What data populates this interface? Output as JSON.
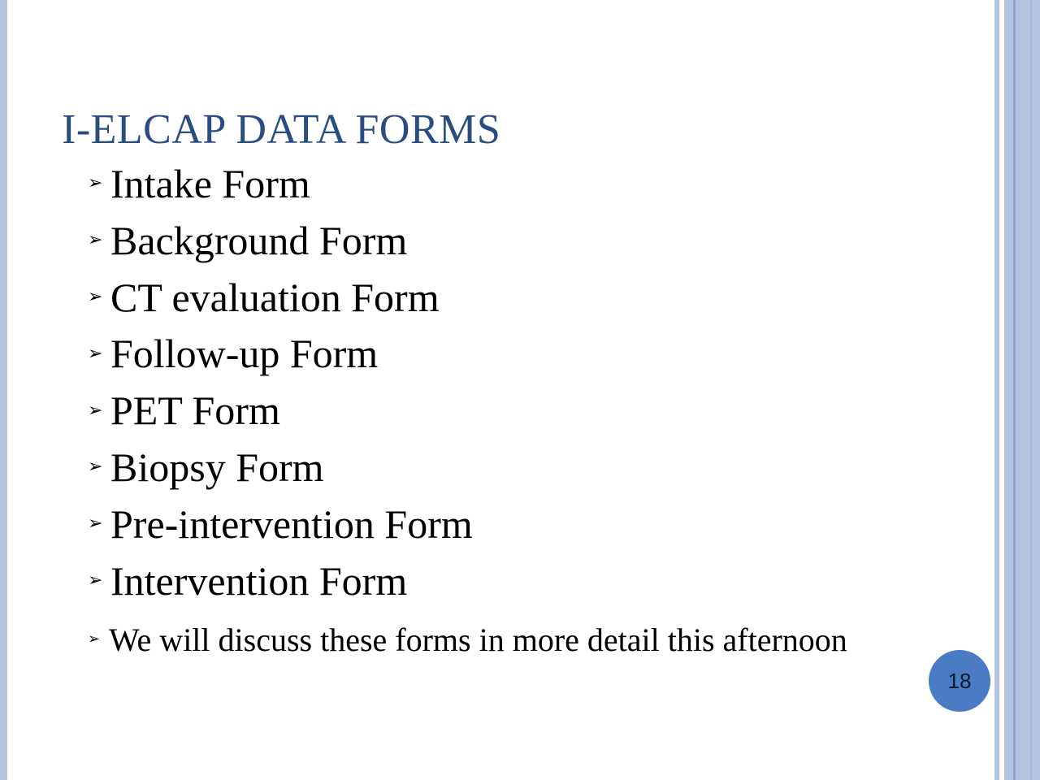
{
  "slide": {
    "title": "I-ELCAP DATA FORMS",
    "bullets": [
      "Intake Form",
      "Background Form",
      "CT evaluation Form",
      "Follow-up Form",
      "PET Form",
      "Biopsy Form",
      "Pre-intervention Form",
      "Intervention Form"
    ],
    "note": "We will discuss these forms in more detail this afternoon",
    "page_number": "18",
    "bullet_glyph": "➢"
  },
  "colors": {
    "title": "#2a4d80",
    "border": "#b3c4de",
    "page_circle": "#4a7bc3"
  }
}
